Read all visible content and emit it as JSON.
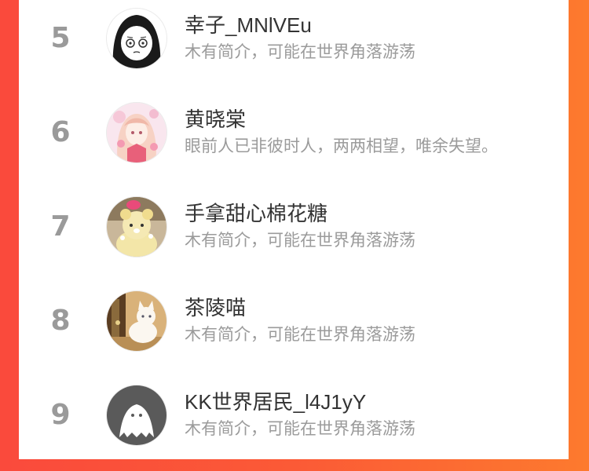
{
  "colors": {
    "accent_left": "#fa4a3c",
    "accent_right": "#fd7a2e",
    "rank": "#9a9a9a",
    "name": "#333333",
    "bio": "#9b9b9b"
  },
  "users": [
    {
      "rank": "5",
      "name": "幸子_MNlVEu",
      "bio": "木有简介，可能在世界角落游荡",
      "avatar": "anime-girl-sketch"
    },
    {
      "rank": "6",
      "name": "黄晓棠",
      "bio": "眼前人已非彼时人，两两相望，唯余失望。",
      "avatar": "pink-anime-girl"
    },
    {
      "rank": "7",
      "name": "手拿甜心棉花糖",
      "bio": "木有简介，可能在世界角落游荡",
      "avatar": "plush-toy"
    },
    {
      "rank": "8",
      "name": "茶陵喵",
      "bio": "木有简介，可能在世界角落游荡",
      "avatar": "white-cat"
    },
    {
      "rank": "9",
      "name": "KK世界居民_l4J1yY",
      "bio": "木有简介，可能在世界角落游荡",
      "avatar": "default-ghost"
    }
  ]
}
